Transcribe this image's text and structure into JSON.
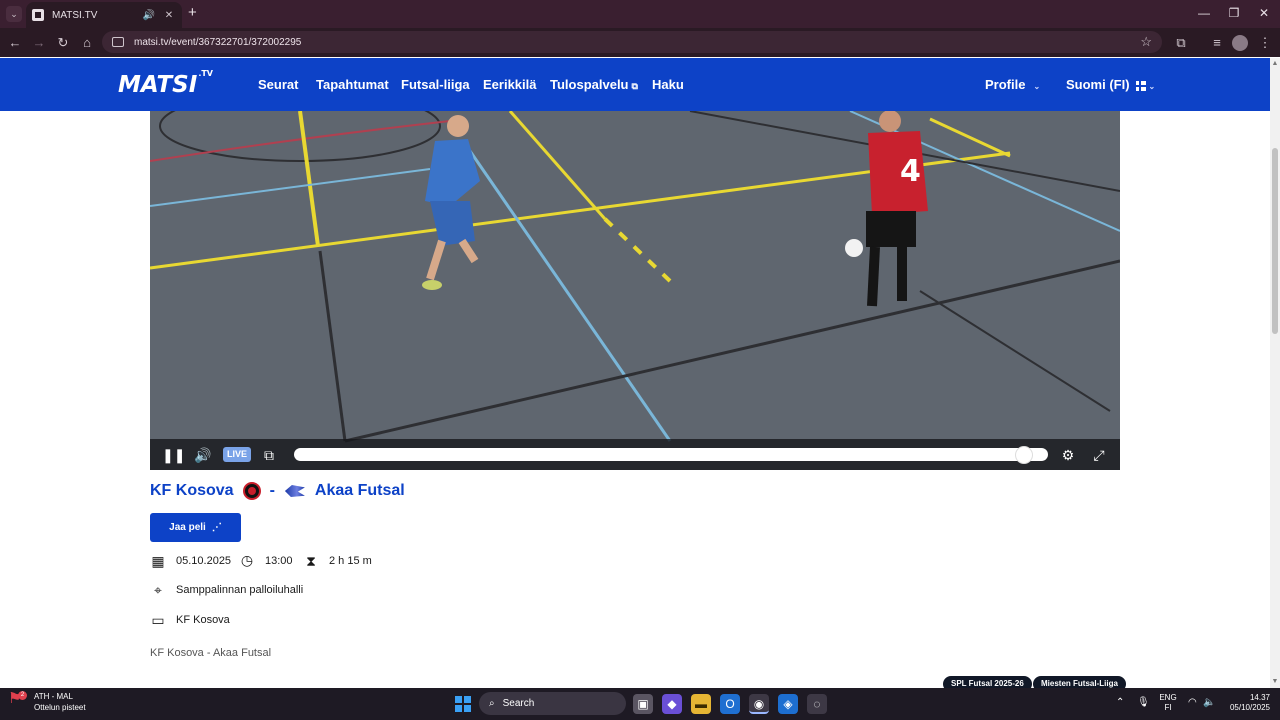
{
  "browser": {
    "tab_title": "MATSI.TV",
    "tab_audio_icon": "🔊",
    "tab_close": "✕",
    "new_tab": "+",
    "url": "matsi.tv/event/367322701/372002295",
    "win_min": "—",
    "win_restore": "❐",
    "win_close": "✕"
  },
  "site": {
    "logo": "MATSI",
    "logo_suffix": ".TV",
    "nav": [
      "Seurat",
      "Tapahtumat",
      "Futsal-liiga",
      "Eerikkilä",
      "Tulospalvelu",
      "Haku"
    ],
    "nav_ext_icon": "⧉",
    "profile": "Profile",
    "language": "Suomi (FI)",
    "chevron": "⌄"
  },
  "player": {
    "live_label": "LIVE",
    "progress_fraction": 0.98,
    "state": "playing"
  },
  "match": {
    "home": "KF Kosova",
    "separator": "-",
    "away": "Akaa Futsal",
    "share_label": "Jaa peli",
    "date": "05.10.2025",
    "time": "13:00",
    "duration": "2 h 15 m",
    "venue": "Samppalinnan palloiluhalli",
    "broadcaster": "KF Kosova",
    "description": "KF Kosova - Akaa Futsal",
    "tags": [
      "SPL Futsal 2025-26",
      "Miesten Futsal-Liiga"
    ]
  },
  "taskbar": {
    "widget_title": "ATH - MAL",
    "widget_sub": "Ottelun pisteet",
    "widget_badge": "2",
    "search_placeholder": "Search",
    "lang_top": "ENG",
    "lang_bottom": "FI",
    "time": "14.37",
    "date": "05/10/2025"
  },
  "colors": {
    "brand_blue": "#0d42c7",
    "chrome_dark": "#2a1a24",
    "taskbar": "#1e1a24"
  }
}
